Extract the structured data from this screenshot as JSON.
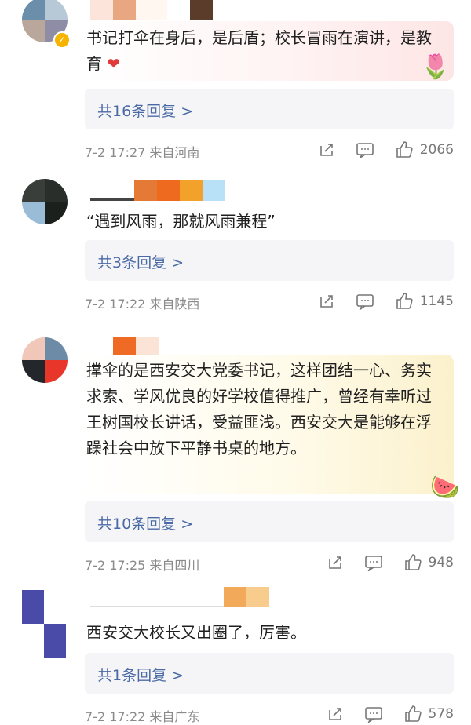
{
  "comments": [
    {
      "text": "书记打伞在身后，是后盾；校长冒雨在演讲，是教育",
      "emoji": "❤",
      "replies_label": "共16条回复 >",
      "meta": "7-2 17:27 来自河南",
      "likes": "2066"
    },
    {
      "text": "“遇到风雨，那就风雨兼程”",
      "replies_label": "共3条回复 >",
      "meta": "7-2 17:22 来自陕西",
      "likes": "1145"
    },
    {
      "text": "撑伞的是西安交大党委书记，这样团结一心、务实求索、学风优良的好学校值得推广，曾经有幸听过王树国校长讲话，受益匪浅。西安交大是能够在浮躁社会中放下平静书桌的地方。",
      "replies_label": "共10条回复 >",
      "meta": "7-2 17:25 来自四川",
      "likes": "948"
    },
    {
      "text": "西安交大校长又出圈了，厉害。",
      "replies_label": "共1条回复 >",
      "meta": "7-2 17:22 来自广东",
      "likes": "578"
    }
  ]
}
